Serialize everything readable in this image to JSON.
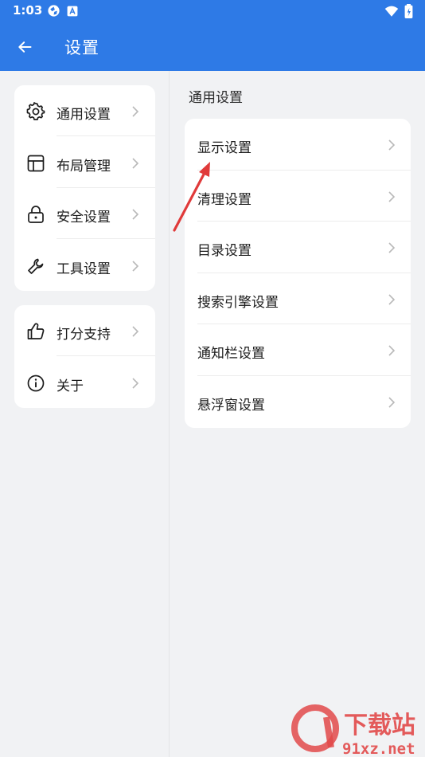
{
  "status_bar": {
    "time": "1:03",
    "icons": [
      "vpn-globe-icon",
      "app-notification-icon",
      "wifi-icon",
      "battery-icon"
    ],
    "color": "#2e7ae6"
  },
  "app_bar": {
    "title": "设置",
    "back_icon": "back-arrow-icon",
    "color": "#2e7ae6"
  },
  "sidebar": {
    "groups": [
      {
        "items": [
          {
            "label": "通用设置",
            "icon": "gear-icon"
          },
          {
            "label": "布局管理",
            "icon": "layout-icon"
          },
          {
            "label": "安全设置",
            "icon": "lock-icon"
          },
          {
            "label": "工具设置",
            "icon": "wrench-icon"
          }
        ]
      },
      {
        "items": [
          {
            "label": "打分支持",
            "icon": "thumbs-up-icon"
          },
          {
            "label": "关于",
            "icon": "info-icon"
          }
        ]
      }
    ]
  },
  "main": {
    "section_title": "通用设置",
    "items": [
      {
        "label": "显示设置"
      },
      {
        "label": "清理设置"
      },
      {
        "label": "目录设置"
      },
      {
        "label": "搜索引擎设置"
      },
      {
        "label": "通知栏设置"
      },
      {
        "label": "悬浮窗设置"
      }
    ]
  },
  "annotation": {
    "color": "#e03a3a"
  },
  "watermark": {
    "text_cn": "下载站",
    "text_url": "91xz.net",
    "color": "#e24a4a"
  }
}
